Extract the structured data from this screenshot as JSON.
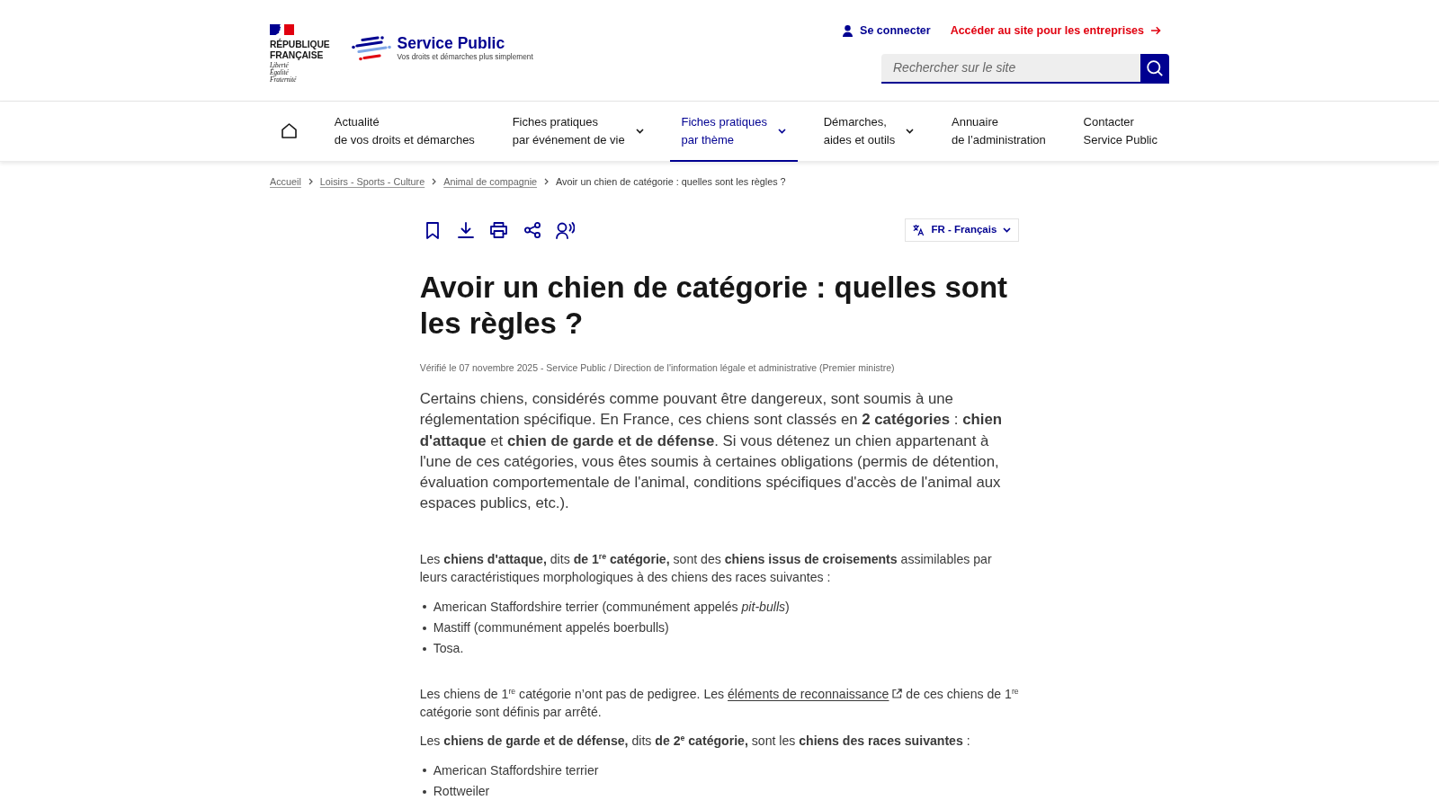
{
  "header": {
    "republic": {
      "name_lines": [
        "RÉPUBLIQUE",
        "FRANÇAISE"
      ],
      "motto_lines": [
        "Liberté",
        "Égalité",
        "Fraternité"
      ]
    },
    "site": {
      "title": "Service Public",
      "tagline": "Vos droits et démarches plus simplement"
    },
    "links": [
      {
        "kind": "account",
        "label": "Se connecter"
      },
      {
        "kind": "redirect",
        "label": "Accéder au site pour les entreprises"
      }
    ],
    "search": {
      "placeholder": "Rechercher sur le site"
    }
  },
  "nav": {
    "items": [
      {
        "kind": "home",
        "selected": false
      },
      {
        "kind": "link",
        "lines": [
          "Actualité",
          "de vos droits et démarches"
        ],
        "dropdown": false,
        "selected": false
      },
      {
        "kind": "link",
        "lines": [
          "Fiches pratiques",
          "par événement de vie"
        ],
        "dropdown": true,
        "selected": false
      },
      {
        "kind": "link",
        "lines": [
          "Fiches pratiques",
          "par thème"
        ],
        "dropdown": true,
        "selected": true
      },
      {
        "kind": "link",
        "lines": [
          "Démarches,",
          "aides et outils"
        ],
        "dropdown": true,
        "selected": false
      },
      {
        "kind": "link",
        "lines": [
          "Annuaire",
          "de l’administration"
        ],
        "dropdown": false,
        "selected": false
      },
      {
        "kind": "link",
        "lines": [
          "Contacter",
          "Service Public"
        ],
        "dropdown": false,
        "selected": false
      }
    ]
  },
  "breadcrumb": [
    {
      "label": "Accueil",
      "current": false
    },
    {
      "label": "Loisirs - Sports - Culture",
      "current": false
    },
    {
      "label": "Animal de compagnie",
      "current": false
    },
    {
      "label": "Avoir un chien de catégorie : quelles sont les règles ?",
      "current": true
    }
  ],
  "article": {
    "language": {
      "label": "FR - Français"
    },
    "title": "Avoir un chien de catégorie : quelles sont les règles ?",
    "meta": "Vérifié le 07 novembre 2025 - Service Public / Direction de l'information légale et administrative (Premier ministre)",
    "intro": "Certains chiens, considérés comme pouvant être dangereux, sont soumis à une réglementation spécifique. En France, ces chiens sont classés en **2 catégories** : **chien d'attaque** et **chien de garde et de défense**. Si vous détenez un chien appartenant à l'une de ces catégories, vous êtes soumis à certaines obligations (permis de détention, évaluation comportementale de l'animal, conditions spécifiques d'accès de l'animal aux espaces publics, etc.).",
    "blocks": [
      {
        "kind": "paragraph",
        "text": "Les **chiens d'attaque,** dits **de 1$^{re}$ catégorie,** sont des **chiens issus de croisements** assimilables par leurs caractéristiques morphologiques à des chiens des races suivantes :"
      },
      {
        "kind": "list",
        "items": [
          "American Staffordshire terrier (communément appelés *pit-bulls*)",
          "Mastiff (communément appelés boerbulls)",
          "Tosa."
        ]
      },
      {
        "kind": "link_paragraph",
        "before": "Les chiens de 1$^{re}$ catégorie n’ont pas de pedigree. Les ",
        "link": {
          "label": "éléments de reconnaissance",
          "external": true
        },
        "after": " de ces chiens de 1$^{re}$ catégorie sont définis par arrêté."
      },
      {
        "kind": "paragraph",
        "text": "Les **chiens de garde et de défense,** dits **de 2$^{e}$ catégorie,** sont les **chiens des races suivantes** :"
      },
      {
        "kind": "list",
        "items": [
          "American Staffordshire terrier",
          "Rottweiler"
        ]
      }
    ]
  }
}
